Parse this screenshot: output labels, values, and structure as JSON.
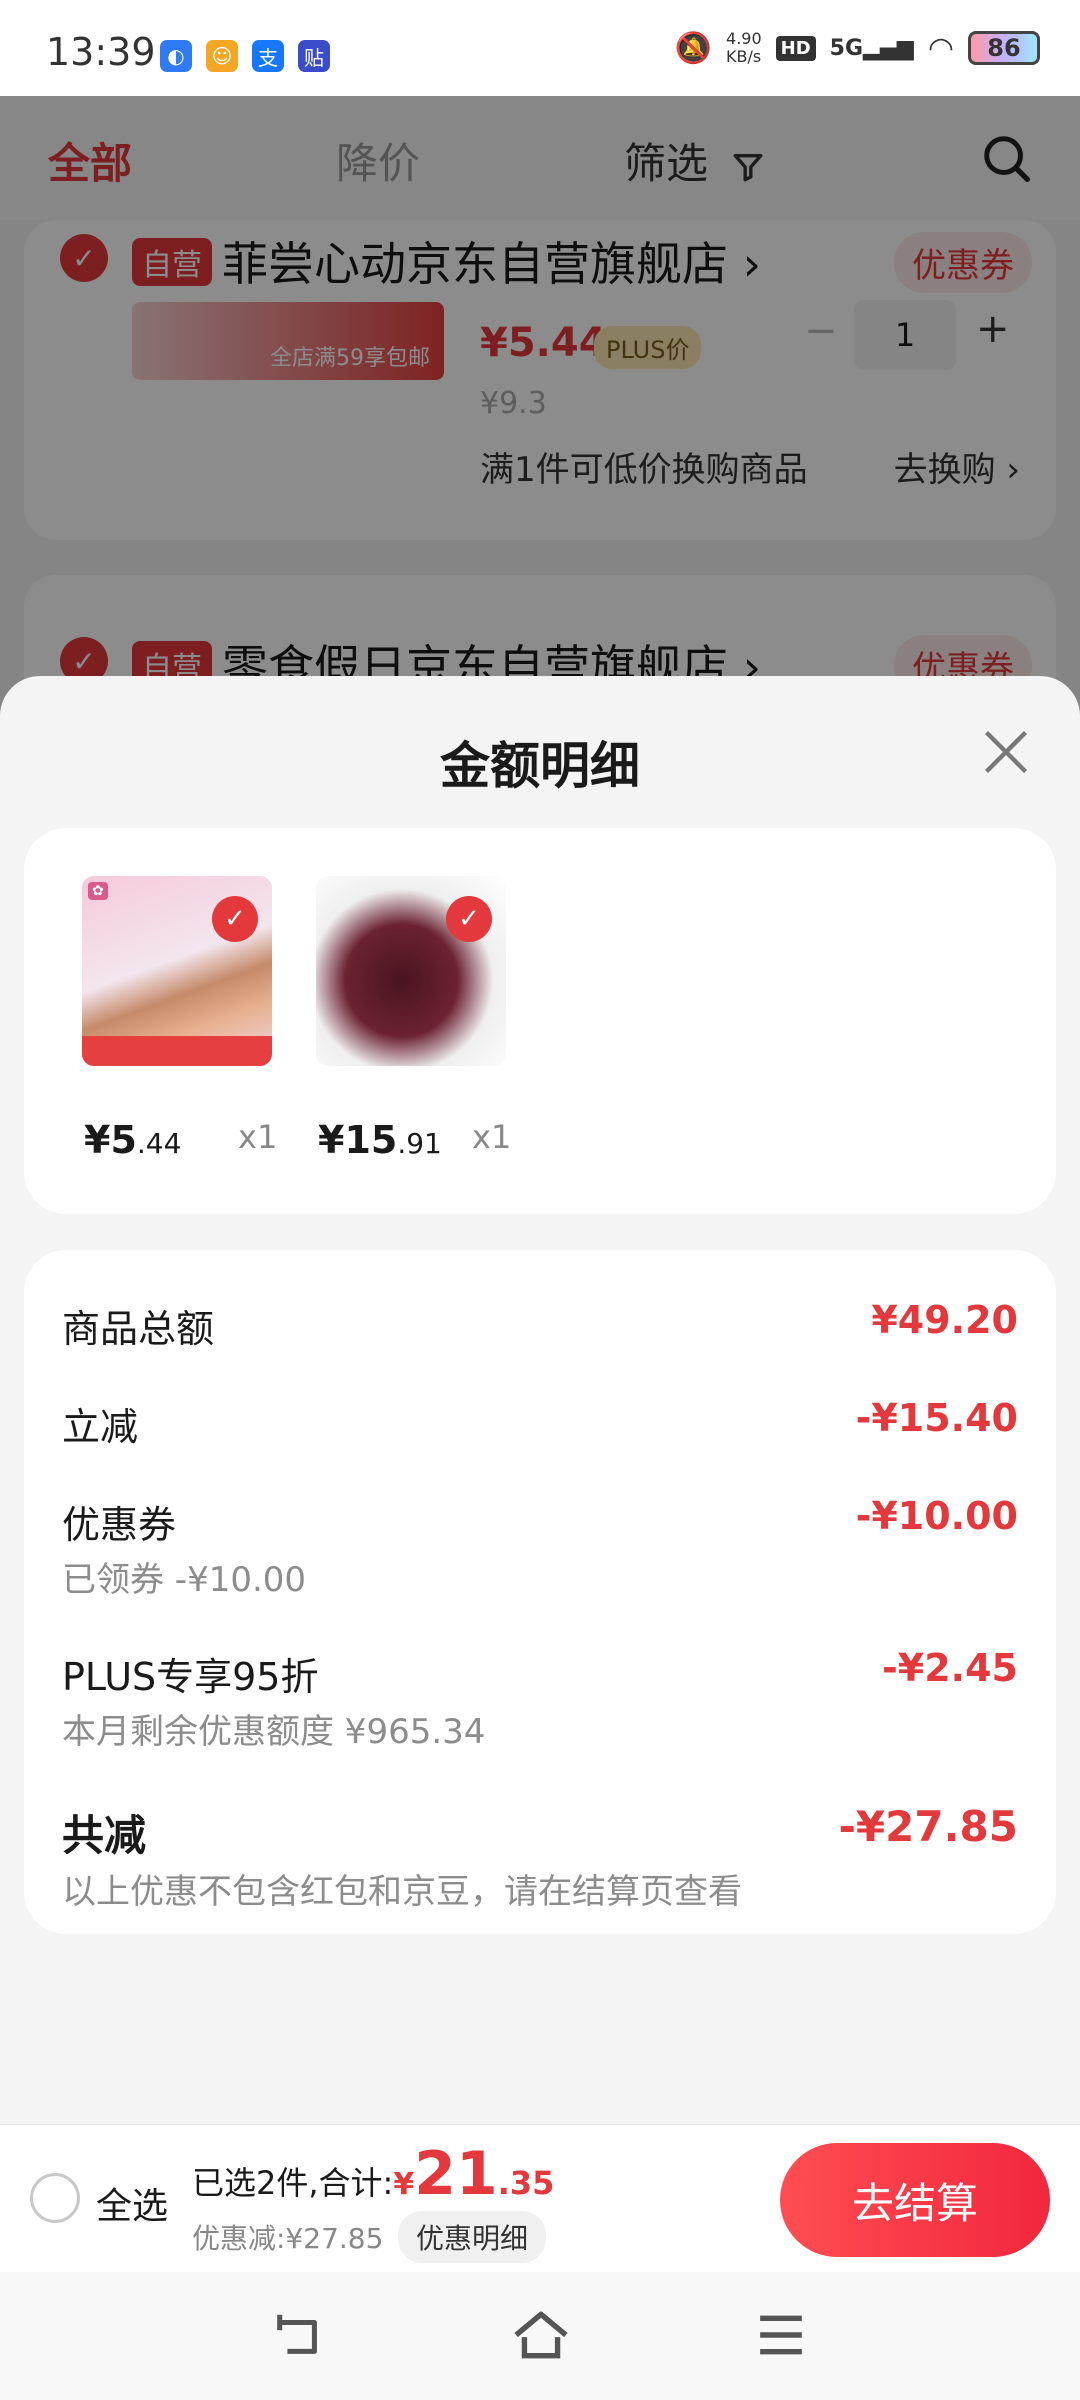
{
  "status_bar": {
    "time": "13:39",
    "net_speed_top": "4.90",
    "net_speed_bottom": "KB/s",
    "hd": "HD",
    "signal": "5G",
    "battery": "86"
  },
  "topbar": {
    "tab_all": "全部",
    "tab_price_drop": "降价",
    "tab_filter": "筛选"
  },
  "store1": {
    "self_run": "自营",
    "name": "菲尝心动京东自营旗舰店 ›",
    "coupon": "优惠券",
    "banner": "全店满59享包邮",
    "price": "¥5.44",
    "plus_tag": "PLUS价",
    "orig_price": "¥9.3",
    "qty": "1",
    "minus": "−",
    "plus": "+",
    "exchange_text": "满1件可低价换购商品",
    "exchange_link": "去换购 ›"
  },
  "store2": {
    "self_run": "自营",
    "name": "零食假日京东自营旗舰店 ›",
    "coupon": "优惠券"
  },
  "sheet": {
    "title": "金额明细",
    "products": [
      {
        "price_int": "¥5",
        "price_dec": ".44",
        "qty": "x1"
      },
      {
        "price_int": "¥15",
        "price_dec": ".91",
        "qty": "x1"
      }
    ],
    "rows": {
      "total_label": "商品总额",
      "total_value": "¥49.20",
      "instant_label": "立减",
      "instant_value": "-¥15.40",
      "coupon_label": "优惠券",
      "coupon_value": "-¥10.00",
      "coupon_sub": "已领券 -¥10.00",
      "plus_label": "PLUS专享95折",
      "plus_value": "-¥2.45",
      "plus_sub": "本月剩余优惠额度 ¥965.34",
      "sum_label": "共减",
      "sum_value": "-¥27.85",
      "sum_sub": "以上优惠不包含红包和京豆，请在结算页查看"
    }
  },
  "bottom": {
    "select_all": "全选",
    "selected_text": "已选2件,合计:",
    "currency": "¥",
    "total_int": "21",
    "total_dec": ".35",
    "discount_text": "优惠减:¥27.85",
    "detail_btn": "优惠明细",
    "checkout": "去结算"
  },
  "colors": {
    "accent": "#e4393c",
    "overlay": "rgba(0,0,0,0.45)"
  },
  "icons": [
    "filter-icon",
    "search-icon",
    "close-icon",
    "check-icon",
    "back-nav-icon",
    "home-nav-icon",
    "menu-nav-icon"
  ]
}
